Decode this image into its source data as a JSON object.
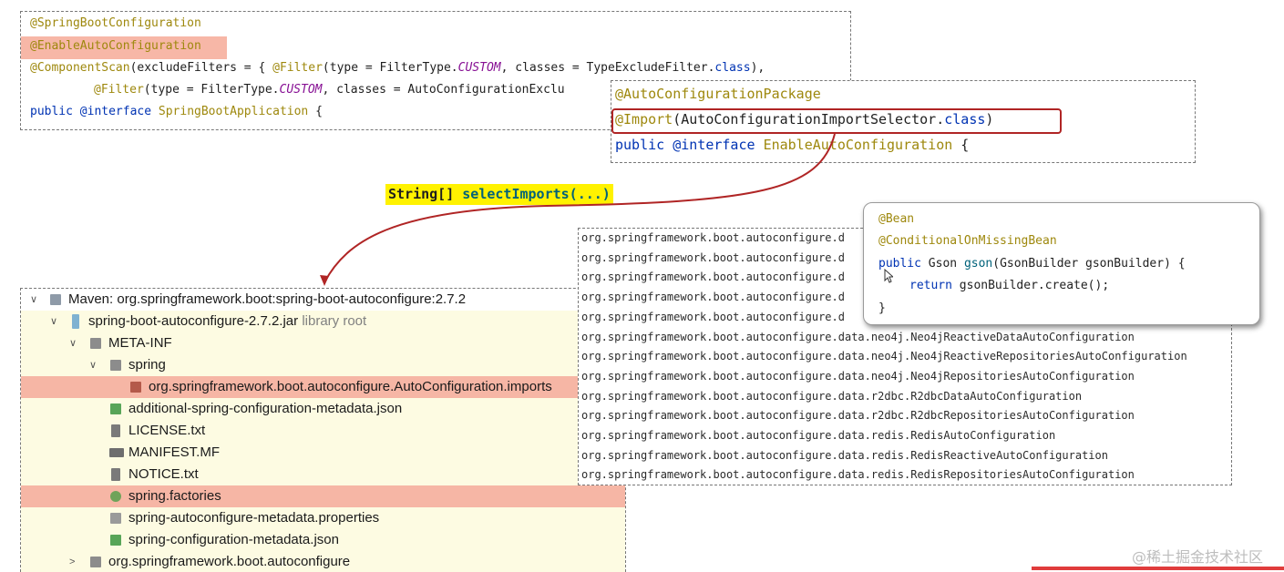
{
  "box1": {
    "l1": "@SpringBootConfiguration",
    "l2": "@EnableAutoConfiguration",
    "l3": {
      "a": "@ComponentScan",
      "b": "(excludeFilters = { ",
      "c": "@Filter",
      "d": "(type = FilterType.",
      "e": "CUSTOM",
      "f": ", classes = TypeExcludeFilter.",
      "g": "class",
      "h": "),"
    },
    "l4": {
      "a": "@Filter",
      "b": "(type = FilterType.",
      "c": "CUSTOM",
      "d": ", classes = AutoConfigurationExclu"
    },
    "l5": {
      "a": "public ",
      "b": "@interface ",
      "c": "SpringBootApplication",
      "d": " {"
    }
  },
  "box2": {
    "l1": "@AutoConfigurationPackage",
    "l2": {
      "a": "@Import",
      "b": "(AutoConfigurationImportSelector.",
      "c": "class",
      "d": ")"
    },
    "l3": {
      "a": "public ",
      "b": "@interface ",
      "c": "EnableAutoConfiguration",
      "d": " {"
    }
  },
  "selector": {
    "type": "String[] ",
    "method": "selectImports(...)"
  },
  "tree": [
    {
      "label": "Maven: org.springframework.boot:spring-boot-autoconfigure:2.7.2",
      "suffix": "",
      "icon": "maven-icon",
      "chev": "∨"
    },
    {
      "label": "spring-boot-autoconfigure-2.7.2.jar",
      "suffix": "library root",
      "icon": "jar-icon",
      "chev": "∨"
    },
    {
      "label": "META-INF",
      "suffix": "",
      "icon": "folder-icon",
      "chev": "∨"
    },
    {
      "label": "spring",
      "suffix": "",
      "icon": "folder-icon",
      "chev": "∨"
    },
    {
      "label": "org.springframework.boot.autoconfigure.AutoConfiguration.imports",
      "suffix": "",
      "icon": "imports-file-icon",
      "chev": ""
    },
    {
      "label": "additional-spring-configuration-metadata.json",
      "suffix": "",
      "icon": "json-file-icon",
      "chev": ""
    },
    {
      "label": "LICENSE.txt",
      "suffix": "",
      "icon": "text-file-icon",
      "chev": ""
    },
    {
      "label": "MANIFEST.MF",
      "suffix": "",
      "icon": "manifest-file-icon",
      "chev": ""
    },
    {
      "label": "NOTICE.txt",
      "suffix": "",
      "icon": "text-file-icon",
      "chev": ""
    },
    {
      "label": "spring.factories",
      "suffix": "",
      "icon": "spring-file-icon",
      "chev": ""
    },
    {
      "label": "spring-autoconfigure-metadata.properties",
      "suffix": "",
      "icon": "properties-file-icon",
      "chev": ""
    },
    {
      "label": "spring-configuration-metadata.json",
      "suffix": "",
      "icon": "json-file-icon",
      "chev": ""
    },
    {
      "label": "org.springframework.boot.autoconfigure",
      "suffix": "",
      "icon": "folder-icon",
      "chev": ">"
    }
  ],
  "list": [
    "org.springframework.boot.autoconfigure.d",
    "org.springframework.boot.autoconfigure.d",
    "org.springframework.boot.autoconfigure.d",
    "org.springframework.boot.autoconfigure.d",
    "org.springframework.boot.autoconfigure.d",
    "org.springframework.boot.autoconfigure.data.neo4j.Neo4jReactiveDataAutoConfiguration",
    "org.springframework.boot.autoconfigure.data.neo4j.Neo4jReactiveRepositoriesAutoConfiguration",
    "org.springframework.boot.autoconfigure.data.neo4j.Neo4jRepositoriesAutoConfiguration",
    "org.springframework.boot.autoconfigure.data.r2dbc.R2dbcDataAutoConfiguration",
    "org.springframework.boot.autoconfigure.data.r2dbc.R2dbcRepositoriesAutoConfiguration",
    "org.springframework.boot.autoconfigure.data.redis.RedisAutoConfiguration",
    "org.springframework.boot.autoconfigure.data.redis.RedisReactiveAutoConfiguration",
    "org.springframework.boot.autoconfigure.data.redis.RedisRepositoriesAutoConfiguration"
  ],
  "bean": {
    "l1": "@Bean",
    "l2": "@ConditionalOnMissingBean",
    "l3": {
      "a": "public ",
      "b": "Gson ",
      "c": "gson",
      "d": "(GsonBuilder gsonBuilder) {"
    },
    "l4": {
      "a": "return ",
      "b": "gsonBuilder.create();"
    },
    "l5": "}"
  },
  "watermark": "@稀土掘金技术社区",
  "colors": {
    "highlight": "#f7b7a7",
    "selector_bg": "#fff200",
    "frame": "#b02525",
    "arrow": "#b02525",
    "tree_bg": "#fdfbe2"
  }
}
